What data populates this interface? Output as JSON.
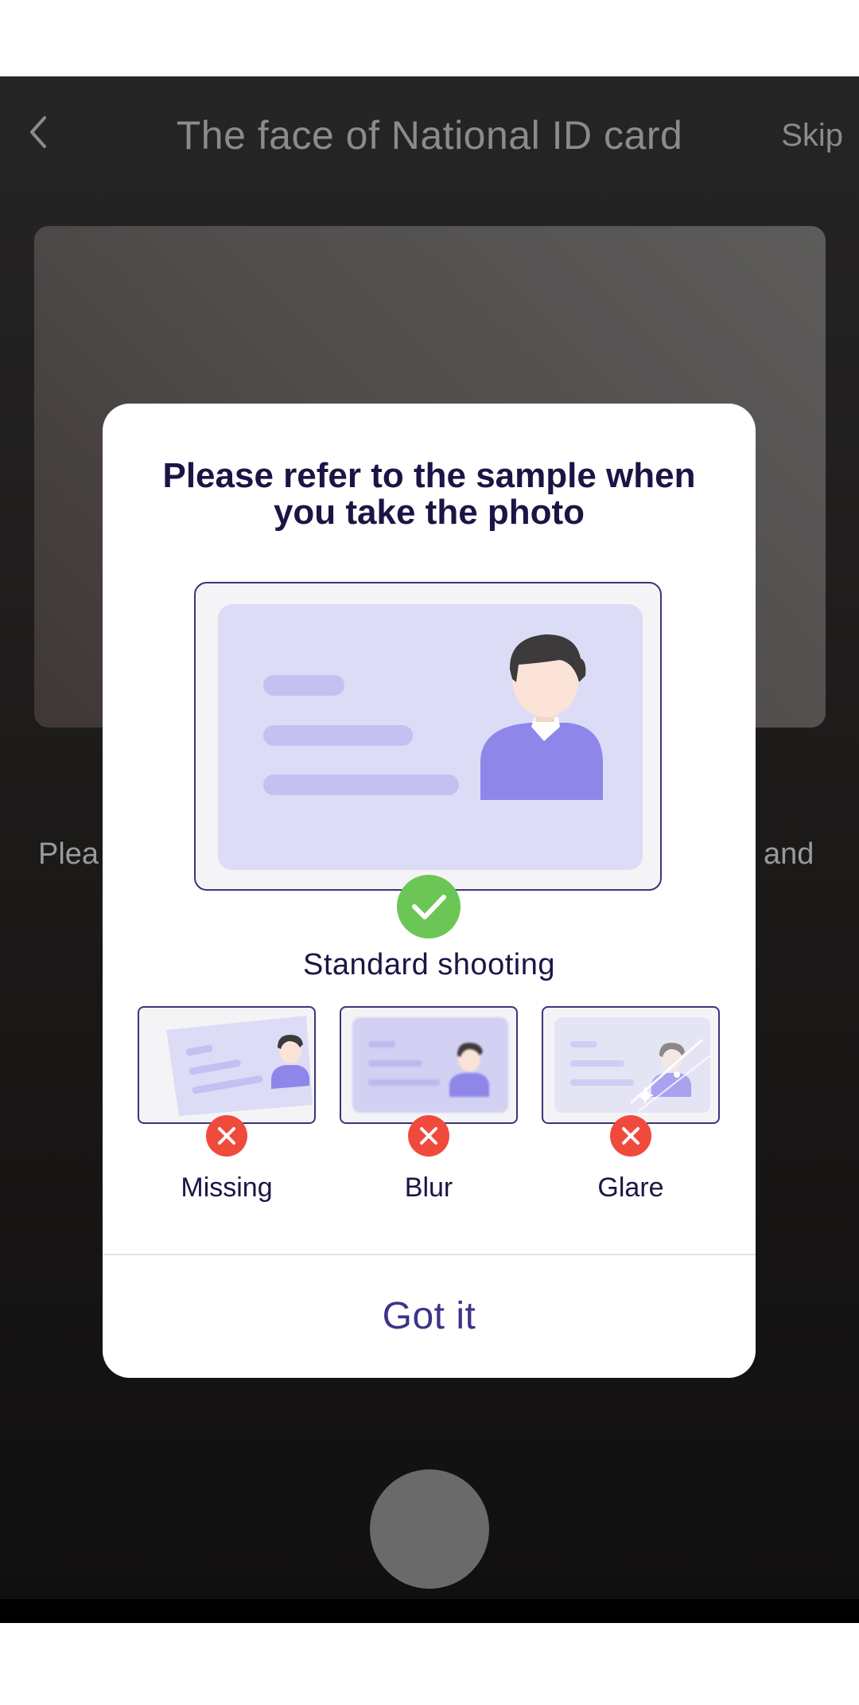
{
  "header": {
    "title": "The face of National ID card",
    "skip_label": "Skip",
    "back_icon": "chevron-left-icon"
  },
  "background_hint": {
    "left_fragment": "Plea",
    "right_fragment": "and"
  },
  "dialog": {
    "title": "Please refer to the sample when you take the photo",
    "sample_caption": "Standard shooting",
    "bad_examples": [
      {
        "label": "Missing",
        "icon": "error-x-icon"
      },
      {
        "label": "Blur",
        "icon": "error-x-icon"
      },
      {
        "label": "Glare",
        "icon": "error-x-icon"
      }
    ],
    "confirm_label": "Got it"
  },
  "colors": {
    "success": "#6cc655",
    "error": "#f04a3c",
    "accent": "#3c3488",
    "card_fill": "#dcdcf6",
    "avatar": "#8f86ea"
  }
}
